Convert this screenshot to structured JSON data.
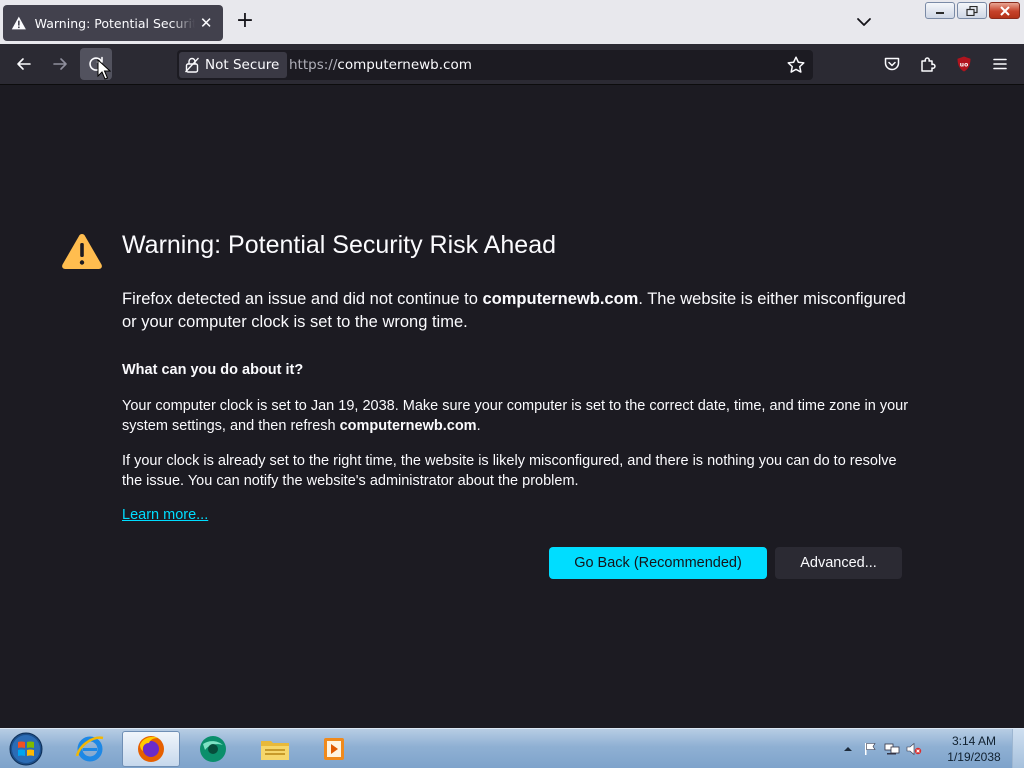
{
  "tab": {
    "title": "Warning: Potential Security Risk Ahead",
    "close_glyph": "✕"
  },
  "tabstrip": {
    "new_tab_glyph": "+"
  },
  "navbar": {
    "identity_label": "Not Secure",
    "url_scheme": "https://",
    "url_host": "computernewb.com"
  },
  "page": {
    "heading": "Warning: Potential Security Risk Ahead",
    "intro_before": "Firefox detected an issue and did not continue to ",
    "intro_host": "computernewb.com",
    "intro_after": ". The website is either misconfigured or your computer clock is set to the wrong time.",
    "subheading": "What can you do about it?",
    "p1_before": "Your computer clock is set to Jan 19, 2038. Make sure your computer is set to the correct date, time, and time zone in your system settings, and then refresh ",
    "p1_host": "computernewb.com",
    "p1_after": ".",
    "p2": "If your clock is already set to the right time, the website is likely misconfigured, and there is nothing you can do to resolve the issue. You can notify the website's administrator about the problem.",
    "learn_more": "Learn more...",
    "go_back_label": "Go Back (Recommended)",
    "advanced_label": "Advanced..."
  },
  "taskbar": {
    "clock_time": "3:14 AM",
    "clock_date": "1/19/2038"
  },
  "colors": {
    "page_bg": "#1c1b22",
    "accent": "#00ddff",
    "warning": "#ffbd4f"
  }
}
